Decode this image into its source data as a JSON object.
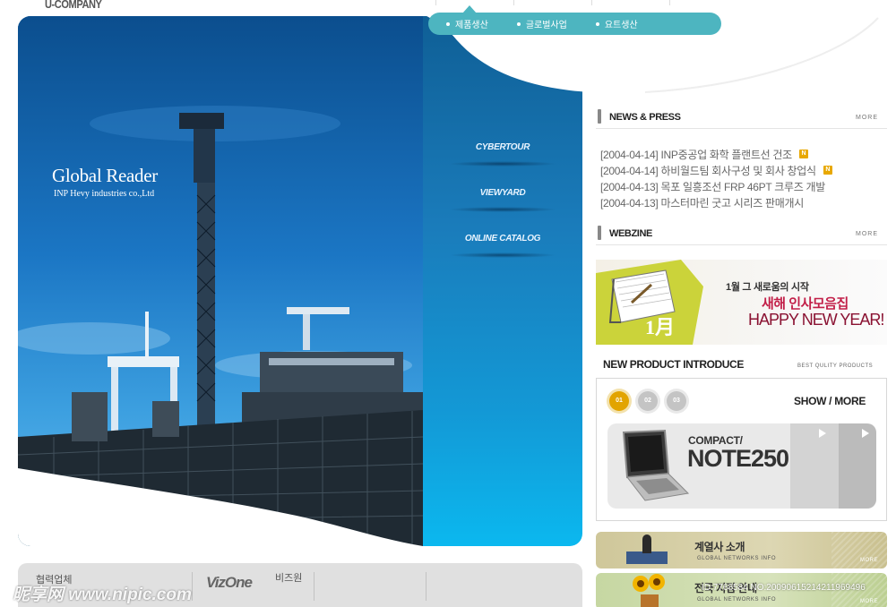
{
  "logo": "U-COMPANY",
  "nav": {
    "items": [
      {
        "label": "제품생산"
      },
      {
        "label": "글로벌사업"
      },
      {
        "label": "요트생산"
      }
    ]
  },
  "hero": {
    "title": "Global Reader",
    "subtitle": "INP Hevy industries co.,Ltd",
    "menu": [
      {
        "label": "CYBERTOUR"
      },
      {
        "label": "VIEWYARD"
      },
      {
        "label": "ONLINE CATALOG"
      }
    ]
  },
  "news": {
    "title": "NEWS & PRESS",
    "more": "MORE",
    "items": [
      {
        "text": "[2004-04-14] INP중공업 화학 플랜트선 건조",
        "is_new": true
      },
      {
        "text": "[2004-04-14] 하비월드팀 회사구성 및 회사 창업식",
        "is_new": true
      },
      {
        "text": "[2004-04-13] 목포 일흥조선 FRP 46PT 크루즈 개발",
        "is_new": false
      },
      {
        "text": "[2004-04-13] 마스터마린 굿고 시리즈 판매개시",
        "is_new": false
      }
    ],
    "new_badge": "N"
  },
  "webzine": {
    "title": "WEBZINE",
    "more": "MORE",
    "line1": "1월 그 새로움의 시작",
    "line2": "새해 인사모음집",
    "line3": "HAPPY NEW YEAR!",
    "month": "1月"
  },
  "product": {
    "title": "NEW PRODUCT INTRODUCE",
    "subtitle": "BEST QULITY PRODUCTS",
    "tabs": [
      "01",
      "02",
      "03"
    ],
    "show_more": "SHOW / MORE",
    "card_label": "COMPACT/",
    "card_model": "NOTE250"
  },
  "banners": [
    {
      "title": "계열사 소개",
      "sub": "GLOBAL NETWORKS INFO",
      "more": "MORE"
    },
    {
      "title": "전국 지점 안내",
      "sub": "GLOBAL NETWORKS INFO",
      "more": "MORE"
    }
  ],
  "bottom": {
    "label1": "협력업체",
    "label2": "비즈원",
    "vizone": "VizOne"
  },
  "watermark": {
    "left": "昵享网 www.nipic.com",
    "right": "ID:7768584 NO:20090615214211969496"
  },
  "colors": {
    "nav_pill": "#4db5c0",
    "hero_blue": "#1a7cbb",
    "new_badge": "#e8a800",
    "tab_active": "#e2a400"
  }
}
